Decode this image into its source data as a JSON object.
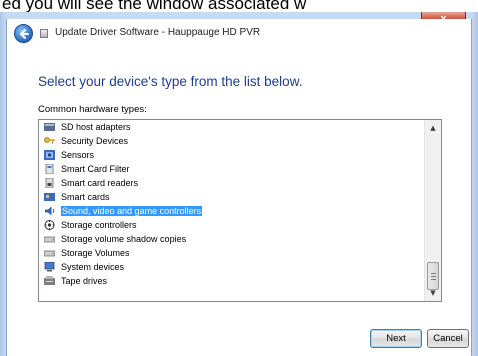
{
  "caption": "ed you will see the window associated w",
  "window": {
    "title": "Update Driver Software - Hauppauge HD PVR",
    "close_glyph": "x"
  },
  "dialog": {
    "heading": "Select your device's type from the list below.",
    "list_label": "Common hardware types:"
  },
  "list": {
    "items": [
      {
        "label": "SD host adapters",
        "icon": "sd-host-adapter-icon"
      },
      {
        "label": "Security Devices",
        "icon": "key-icon"
      },
      {
        "label": "Sensors",
        "icon": "sensor-icon"
      },
      {
        "label": "Smart Card Filter",
        "icon": "smart-card-filter-icon"
      },
      {
        "label": "Smart card readers",
        "icon": "smart-card-reader-icon"
      },
      {
        "label": "Smart cards",
        "icon": "smart-card-icon"
      },
      {
        "label": "Sound, video and game controllers",
        "icon": "speaker-icon"
      },
      {
        "label": "Storage controllers",
        "icon": "storage-controller-icon"
      },
      {
        "label": "Storage volume shadow copies",
        "icon": "drive-icon"
      },
      {
        "label": "Storage Volumes",
        "icon": "drive-icon"
      },
      {
        "label": "System devices",
        "icon": "computer-icon"
      },
      {
        "label": "Tape drives",
        "icon": "tape-drive-icon"
      }
    ],
    "selected_index": 6
  },
  "buttons": {
    "next": "Next",
    "cancel": "Cancel"
  },
  "colors": {
    "heading": "#1e3d8f",
    "selection": "#3399ff",
    "frame": "#c6dbf2"
  }
}
